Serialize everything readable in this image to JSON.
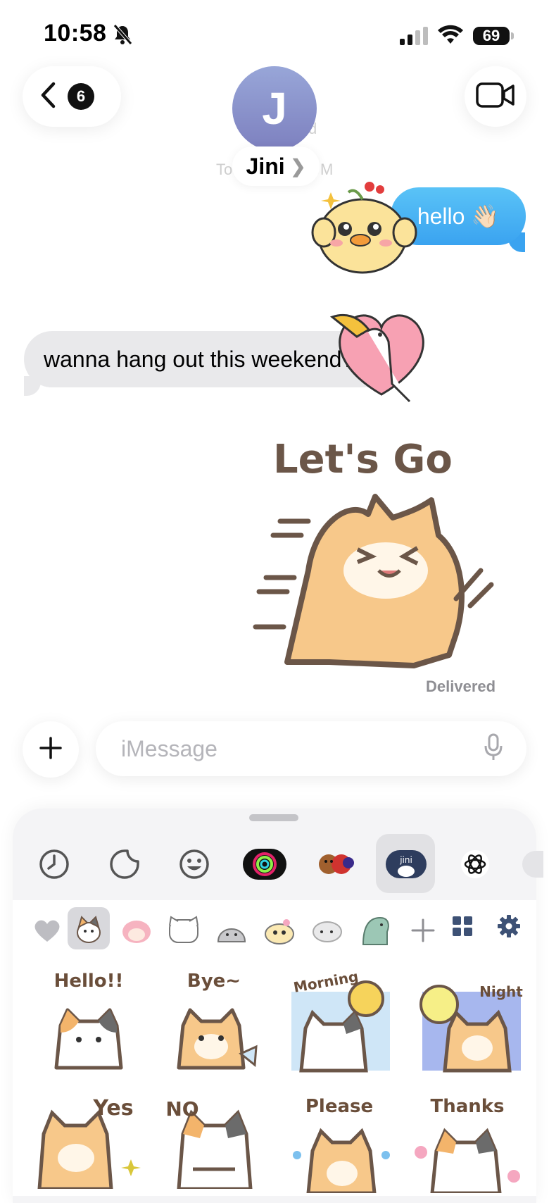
{
  "status_bar": {
    "time": "10:58",
    "battery": "69"
  },
  "header": {
    "back_count": "6",
    "avatar_initial": "J",
    "contact_name": "Jini",
    "ghost_left": "To",
    "ghost_right": "M",
    "ghost_top": "d"
  },
  "messages": {
    "outgoing_text": "hello 👋🏻",
    "incoming_text": "wanna hang out this weekend?",
    "sticker_caption": "Let's Go",
    "status": "Delivered"
  },
  "composer": {
    "placeholder": "iMessage"
  },
  "app_drawer": {
    "apps": [
      "recents-icon",
      "stickers-icon",
      "emoji-icon",
      "activity-icon",
      "memoji-icon",
      "jini-sticker-app-icon",
      "chatgpt-icon"
    ],
    "selected_app_label": "Jini"
  },
  "sticker_pack": {
    "row1": [
      "Hello!!",
      "Bye~",
      "Morning",
      "Night"
    ],
    "row2": [
      "Yes",
      "NO",
      "Please",
      "Thanks"
    ]
  },
  "colors": {
    "imessage_blue": "#3aa3f0",
    "incoming_gray": "#e9e9eb",
    "avatar": "#8a90cc"
  }
}
